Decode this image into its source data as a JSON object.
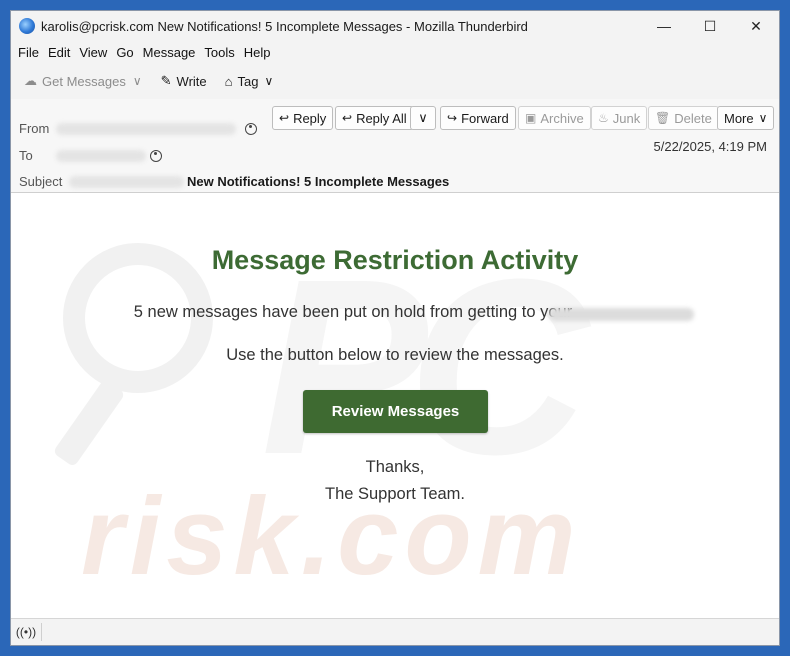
{
  "window": {
    "title": "karolis@pcrisk.com New Notifications! 5 Incomplete Messages - Mozilla Thunderbird",
    "controls": {
      "minimize": "—",
      "maximize": "☐",
      "close": "✕"
    }
  },
  "menubar": [
    "File",
    "Edit",
    "View",
    "Go",
    "Message",
    "Tools",
    "Help"
  ],
  "toolbar": {
    "get_messages": "Get Messages",
    "write": "Write",
    "tag": "Tag"
  },
  "header": {
    "from_label": "From",
    "to_label": "To",
    "subject_label": "Subject",
    "subject": "New Notifications! 5 Incomplete Messages",
    "date": "5/22/2025, 4:19 PM",
    "buttons": {
      "reply": "Reply",
      "reply_all": "Reply All",
      "forward": "Forward",
      "archive": "Archive",
      "junk": "Junk",
      "delete": "Delete",
      "more": "More"
    }
  },
  "message": {
    "title": "Message Restriction Activity",
    "line1": "5 new messages have been put on hold from getting to your",
    "line2": "Use the button below to review the messages.",
    "cta": "Review Messages",
    "thanks": "Thanks,",
    "signature": "The Support Team."
  },
  "watermark": {
    "text": "risk.com",
    "logo": "PC"
  },
  "icons": {
    "app": "thunderbird-icon",
    "status": "radio-icon"
  },
  "colors": {
    "accent_green": "#3e6a31",
    "title_green": "#3d6b34",
    "desktop": "#2b67b8"
  }
}
